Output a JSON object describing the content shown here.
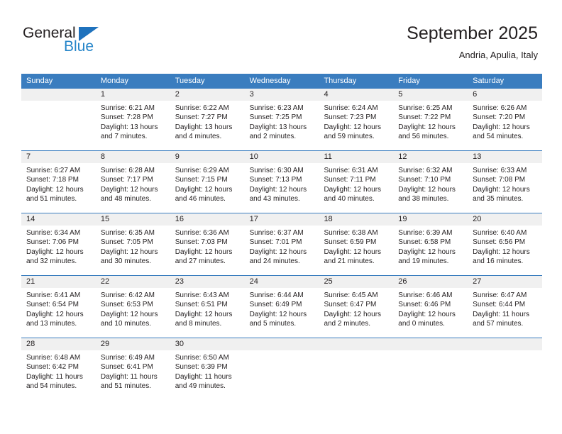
{
  "brand": {
    "name_top": "General",
    "name_bottom": "Blue",
    "triangle_color": "#1f72bd",
    "text_color": "#231f20",
    "blue_text_color": "#2585c9"
  },
  "header": {
    "title": "September 2025",
    "subtitle": "Andria, Apulia, Italy"
  },
  "theme": {
    "header_row_bg": "#3a7dbf",
    "header_row_text": "#ffffff",
    "day_band_bg": "#f0f0f0",
    "cell_bg": "#ffffff",
    "separator": "#3a7dbf",
    "body_text": "#231f20"
  },
  "weekdays": [
    "Sunday",
    "Monday",
    "Tuesday",
    "Wednesday",
    "Thursday",
    "Friday",
    "Saturday"
  ],
  "weeks": [
    [
      {
        "day": "",
        "lines": []
      },
      {
        "day": "1",
        "lines": [
          "Sunrise: 6:21 AM",
          "Sunset: 7:28 PM",
          "Daylight: 13 hours",
          "and 7 minutes."
        ]
      },
      {
        "day": "2",
        "lines": [
          "Sunrise: 6:22 AM",
          "Sunset: 7:27 PM",
          "Daylight: 13 hours",
          "and 4 minutes."
        ]
      },
      {
        "day": "3",
        "lines": [
          "Sunrise: 6:23 AM",
          "Sunset: 7:25 PM",
          "Daylight: 13 hours",
          "and 2 minutes."
        ]
      },
      {
        "day": "4",
        "lines": [
          "Sunrise: 6:24 AM",
          "Sunset: 7:23 PM",
          "Daylight: 12 hours",
          "and 59 minutes."
        ]
      },
      {
        "day": "5",
        "lines": [
          "Sunrise: 6:25 AM",
          "Sunset: 7:22 PM",
          "Daylight: 12 hours",
          "and 56 minutes."
        ]
      },
      {
        "day": "6",
        "lines": [
          "Sunrise: 6:26 AM",
          "Sunset: 7:20 PM",
          "Daylight: 12 hours",
          "and 54 minutes."
        ]
      }
    ],
    [
      {
        "day": "7",
        "lines": [
          "Sunrise: 6:27 AM",
          "Sunset: 7:18 PM",
          "Daylight: 12 hours",
          "and 51 minutes."
        ]
      },
      {
        "day": "8",
        "lines": [
          "Sunrise: 6:28 AM",
          "Sunset: 7:17 PM",
          "Daylight: 12 hours",
          "and 48 minutes."
        ]
      },
      {
        "day": "9",
        "lines": [
          "Sunrise: 6:29 AM",
          "Sunset: 7:15 PM",
          "Daylight: 12 hours",
          "and 46 minutes."
        ]
      },
      {
        "day": "10",
        "lines": [
          "Sunrise: 6:30 AM",
          "Sunset: 7:13 PM",
          "Daylight: 12 hours",
          "and 43 minutes."
        ]
      },
      {
        "day": "11",
        "lines": [
          "Sunrise: 6:31 AM",
          "Sunset: 7:11 PM",
          "Daylight: 12 hours",
          "and 40 minutes."
        ]
      },
      {
        "day": "12",
        "lines": [
          "Sunrise: 6:32 AM",
          "Sunset: 7:10 PM",
          "Daylight: 12 hours",
          "and 38 minutes."
        ]
      },
      {
        "day": "13",
        "lines": [
          "Sunrise: 6:33 AM",
          "Sunset: 7:08 PM",
          "Daylight: 12 hours",
          "and 35 minutes."
        ]
      }
    ],
    [
      {
        "day": "14",
        "lines": [
          "Sunrise: 6:34 AM",
          "Sunset: 7:06 PM",
          "Daylight: 12 hours",
          "and 32 minutes."
        ]
      },
      {
        "day": "15",
        "lines": [
          "Sunrise: 6:35 AM",
          "Sunset: 7:05 PM",
          "Daylight: 12 hours",
          "and 30 minutes."
        ]
      },
      {
        "day": "16",
        "lines": [
          "Sunrise: 6:36 AM",
          "Sunset: 7:03 PM",
          "Daylight: 12 hours",
          "and 27 minutes."
        ]
      },
      {
        "day": "17",
        "lines": [
          "Sunrise: 6:37 AM",
          "Sunset: 7:01 PM",
          "Daylight: 12 hours",
          "and 24 minutes."
        ]
      },
      {
        "day": "18",
        "lines": [
          "Sunrise: 6:38 AM",
          "Sunset: 6:59 PM",
          "Daylight: 12 hours",
          "and 21 minutes."
        ]
      },
      {
        "day": "19",
        "lines": [
          "Sunrise: 6:39 AM",
          "Sunset: 6:58 PM",
          "Daylight: 12 hours",
          "and 19 minutes."
        ]
      },
      {
        "day": "20",
        "lines": [
          "Sunrise: 6:40 AM",
          "Sunset: 6:56 PM",
          "Daylight: 12 hours",
          "and 16 minutes."
        ]
      }
    ],
    [
      {
        "day": "21",
        "lines": [
          "Sunrise: 6:41 AM",
          "Sunset: 6:54 PM",
          "Daylight: 12 hours",
          "and 13 minutes."
        ]
      },
      {
        "day": "22",
        "lines": [
          "Sunrise: 6:42 AM",
          "Sunset: 6:53 PM",
          "Daylight: 12 hours",
          "and 10 minutes."
        ]
      },
      {
        "day": "23",
        "lines": [
          "Sunrise: 6:43 AM",
          "Sunset: 6:51 PM",
          "Daylight: 12 hours",
          "and 8 minutes."
        ]
      },
      {
        "day": "24",
        "lines": [
          "Sunrise: 6:44 AM",
          "Sunset: 6:49 PM",
          "Daylight: 12 hours",
          "and 5 minutes."
        ]
      },
      {
        "day": "25",
        "lines": [
          "Sunrise: 6:45 AM",
          "Sunset: 6:47 PM",
          "Daylight: 12 hours",
          "and 2 minutes."
        ]
      },
      {
        "day": "26",
        "lines": [
          "Sunrise: 6:46 AM",
          "Sunset: 6:46 PM",
          "Daylight: 12 hours",
          "and 0 minutes."
        ]
      },
      {
        "day": "27",
        "lines": [
          "Sunrise: 6:47 AM",
          "Sunset: 6:44 PM",
          "Daylight: 11 hours",
          "and 57 minutes."
        ]
      }
    ],
    [
      {
        "day": "28",
        "lines": [
          "Sunrise: 6:48 AM",
          "Sunset: 6:42 PM",
          "Daylight: 11 hours",
          "and 54 minutes."
        ]
      },
      {
        "day": "29",
        "lines": [
          "Sunrise: 6:49 AM",
          "Sunset: 6:41 PM",
          "Daylight: 11 hours",
          "and 51 minutes."
        ]
      },
      {
        "day": "30",
        "lines": [
          "Sunrise: 6:50 AM",
          "Sunset: 6:39 PM",
          "Daylight: 11 hours",
          "and 49 minutes."
        ]
      },
      {
        "day": "",
        "lines": []
      },
      {
        "day": "",
        "lines": []
      },
      {
        "day": "",
        "lines": []
      },
      {
        "day": "",
        "lines": []
      }
    ]
  ]
}
